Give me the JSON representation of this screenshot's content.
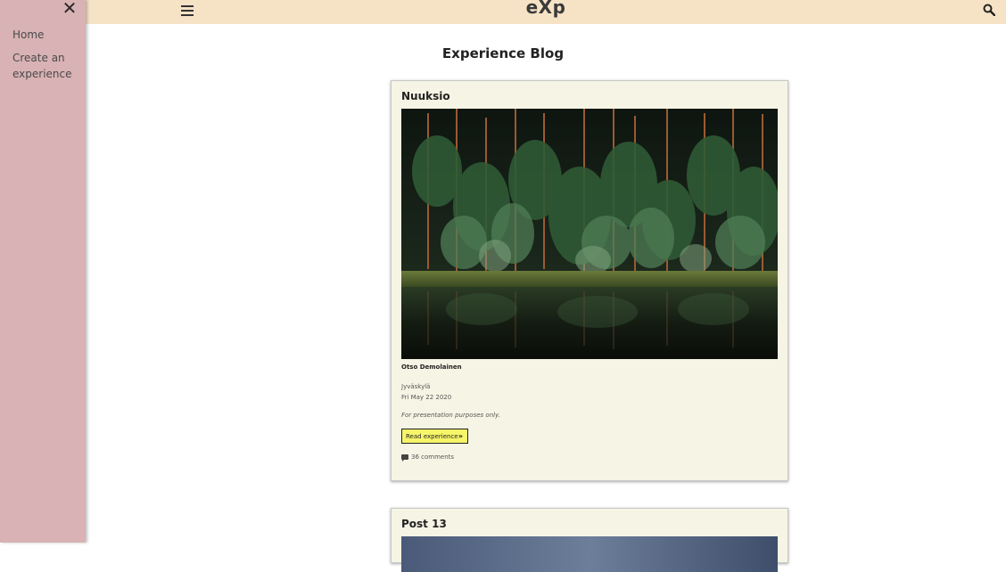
{
  "sidebar": {
    "close_glyph": "✕",
    "items": [
      {
        "label": "Home"
      },
      {
        "label": "Create an experience"
      }
    ]
  },
  "header": {
    "brand": "eXp",
    "icons": [
      "menu-icon",
      "search-icon"
    ]
  },
  "page": {
    "title": "Experience Blog"
  },
  "posts": [
    {
      "title": "Nuuksio",
      "image": "forest-lake-photo",
      "author": "Otso Demolainen",
      "location": "Jyväskylä",
      "date": "Fri May 22 2020",
      "description": "For presentation purposes only.",
      "read_label": "Read experience",
      "comments": "36 comments"
    },
    {
      "title": "Post 13",
      "image": "sky-photo"
    }
  ],
  "colors": {
    "sidebar_bg": "#d8b2b4",
    "header_bg": "#f6e3c6",
    "card_bg": "#f6f4e4",
    "button_bg": "#f7f56a"
  }
}
